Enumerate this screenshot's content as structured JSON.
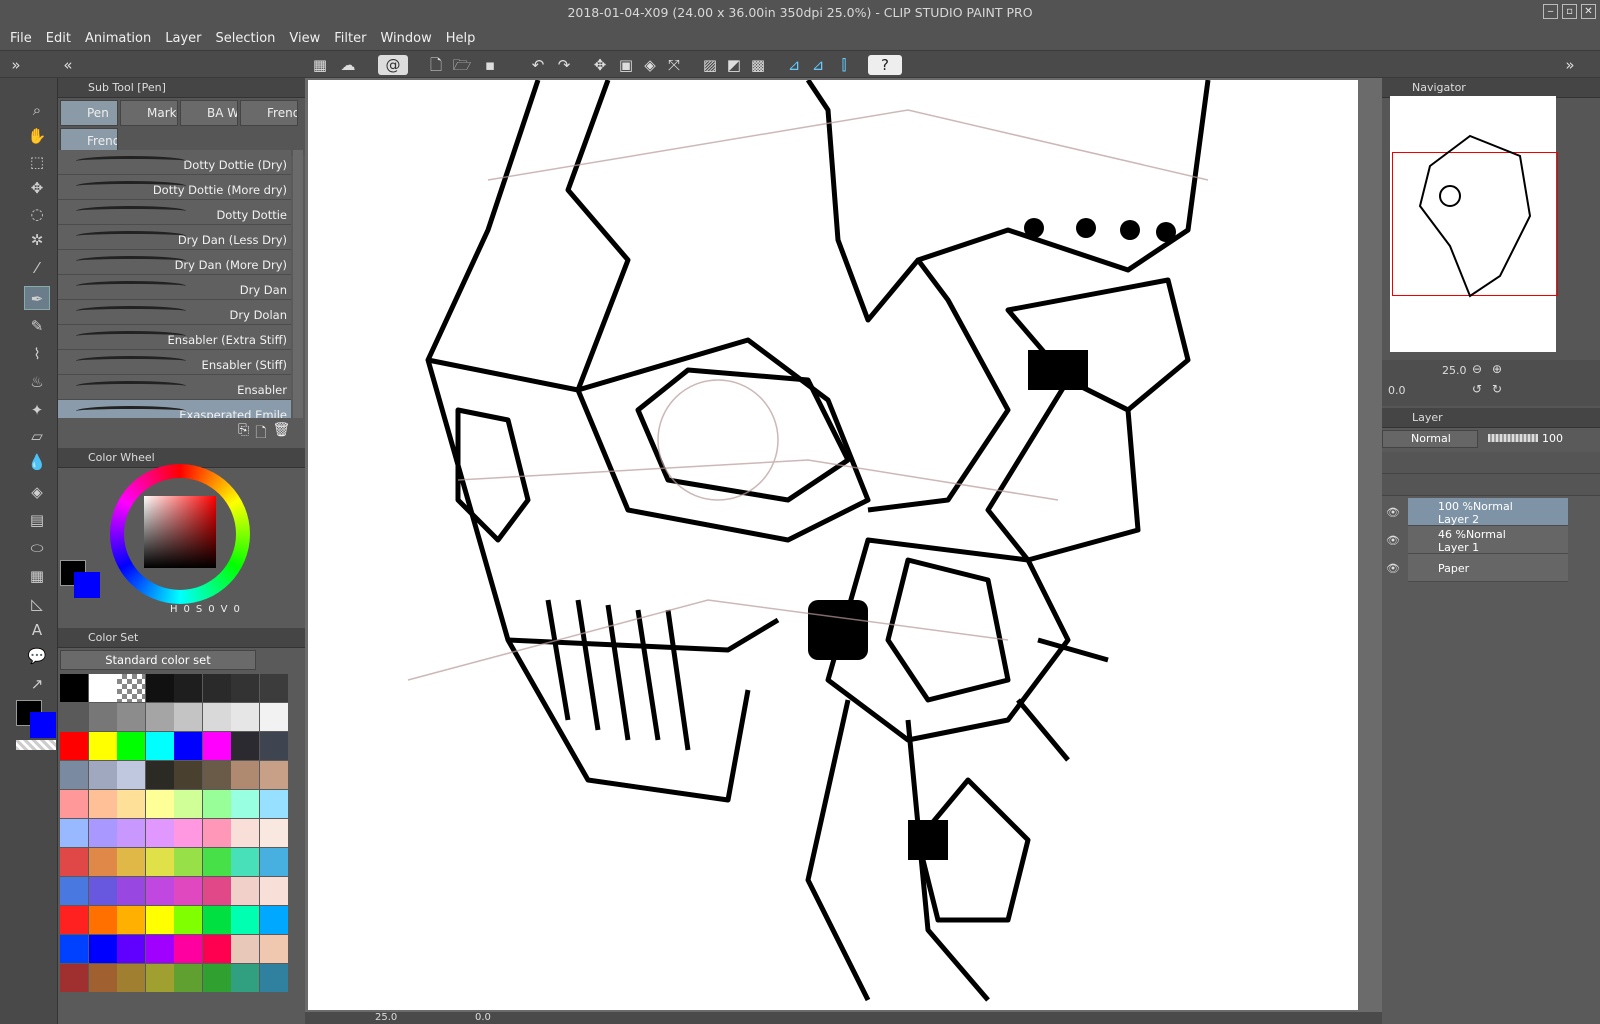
{
  "window": {
    "title": "2018-01-04-X09 (24.00 x 36.00in 350dpi 25.0%)  - CLIP STUDIO PAINT PRO"
  },
  "menu": [
    "File",
    "Edit",
    "Animation",
    "Layer",
    "Selection",
    "View",
    "Filter",
    "Window",
    "Help"
  ],
  "subtool": {
    "header": "Sub Tool [Pen]",
    "tabs": [
      "Pen",
      "Marke",
      "BA W:",
      "Frend",
      "Frend"
    ],
    "brushes": [
      "Dotty Dottie (Dry)",
      "Dotty Dottie (More dry)",
      "Dotty Dottie",
      "Dry Dan (Less Dry)",
      "Dry Dan (More Dry)",
      "Dry Dan",
      "Dry Dolan",
      "Ensabler (Extra Stiff)",
      "Ensabler (Stiff)",
      "Ensabler",
      "Exasperated Emile"
    ]
  },
  "colorwheel": {
    "header": "Color Wheel",
    "h": "0",
    "s": "0",
    "v": "0",
    "h_label": "H",
    "s_label": "S",
    "v_label": "V",
    "main_color": "#000000",
    "sub_color": "#0000ff"
  },
  "colorset": {
    "header": "Color Set",
    "set_name": "Standard color set"
  },
  "navigator": {
    "header": "Navigator",
    "zoom": "25.0",
    "rotation": "0.0"
  },
  "layer": {
    "header": "Layer",
    "blend": "Normal",
    "opacity": "100",
    "layers": [
      {
        "opacity": "100 %Normal",
        "name": "Layer 2"
      },
      {
        "opacity": "46 %Normal",
        "name": "Layer 1"
      },
      {
        "opacity": "",
        "name": "Paper"
      }
    ]
  },
  "canvas_status": {
    "zoom": "25.0",
    "angle": "0.0"
  },
  "swatch_colors": [
    [
      "#000000",
      "#ffffff",
      "checker",
      "#111111",
      "#1e1e1e",
      "#2a2a2a",
      "#333333",
      "#3c3c3c"
    ],
    [
      "#5a5a5a",
      "#777777",
      "#8c8c8c",
      "#a5a5a5",
      "#c4c4c4",
      "#d9d9d9",
      "#e6e6e6",
      "#f2f2f2"
    ],
    [
      "#ff0000",
      "#ffff00",
      "#00ff00",
      "#00ffff",
      "#0000ff",
      "#ff00ff",
      "#2a2a30",
      "#3e4450"
    ],
    [
      "#7a8aa0",
      "#a0a8c0",
      "#c0c8e0",
      "#2c2a24",
      "#4a4030",
      "#6a5a48",
      "#b08a70",
      "#c8a088"
    ],
    [
      "#ff9898",
      "#ffc098",
      "#ffe098",
      "#ffff98",
      "#d0ff98",
      "#98ff98",
      "#98ffe0",
      "#98e0ff"
    ],
    [
      "#98b8ff",
      "#a898ff",
      "#c898ff",
      "#e098ff",
      "#ff98e0",
      "#ff98b8",
      "#f8e0d8",
      "#f8e8e0"
    ],
    [
      "#e04848",
      "#e08848",
      "#e0b848",
      "#e0e048",
      "#98e048",
      "#48e048",
      "#48e0b8",
      "#48b0e0"
    ],
    [
      "#4878e0",
      "#6858e0",
      "#9848e0",
      "#c048e0",
      "#e048c0",
      "#e04888",
      "#f0d0c8",
      "#f8e0d8"
    ],
    [
      "#ff2020",
      "#ff7000",
      "#ffb000",
      "#ffff00",
      "#80ff00",
      "#00e040",
      "#00ffb0",
      "#00a8ff"
    ],
    [
      "#0040ff",
      "#0000ff",
      "#6000ff",
      "#a000ff",
      "#ff00a0",
      "#ff0050",
      "#e8c8b8",
      "#f0c8b0"
    ],
    [
      "#a03030",
      "#a06030",
      "#a08030",
      "#a0a030",
      "#60a030",
      "#30a030",
      "#30a080",
      "#3080a0"
    ]
  ]
}
